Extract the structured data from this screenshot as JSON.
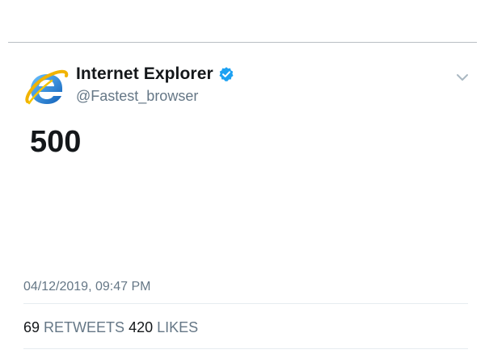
{
  "tweet": {
    "display_name": "Internet Explorer",
    "handle": "@Fastest_browser",
    "text": "500",
    "timestamp": "04/12/2019, 09:47 PM",
    "retweets_count": "69",
    "retweets_label": "RETWEETS",
    "likes_count": "420",
    "likes_label": "LIKES",
    "avatar_icon": "internet-explorer-logo",
    "verified_icon": "verified-badge-icon",
    "caret_icon": "chevron-down-icon"
  },
  "colors": {
    "verified_blue": "#1da1f2",
    "ie_blue": "#1f7fd6",
    "ie_ring": "#f1b300",
    "secondary_text": "#657786"
  }
}
